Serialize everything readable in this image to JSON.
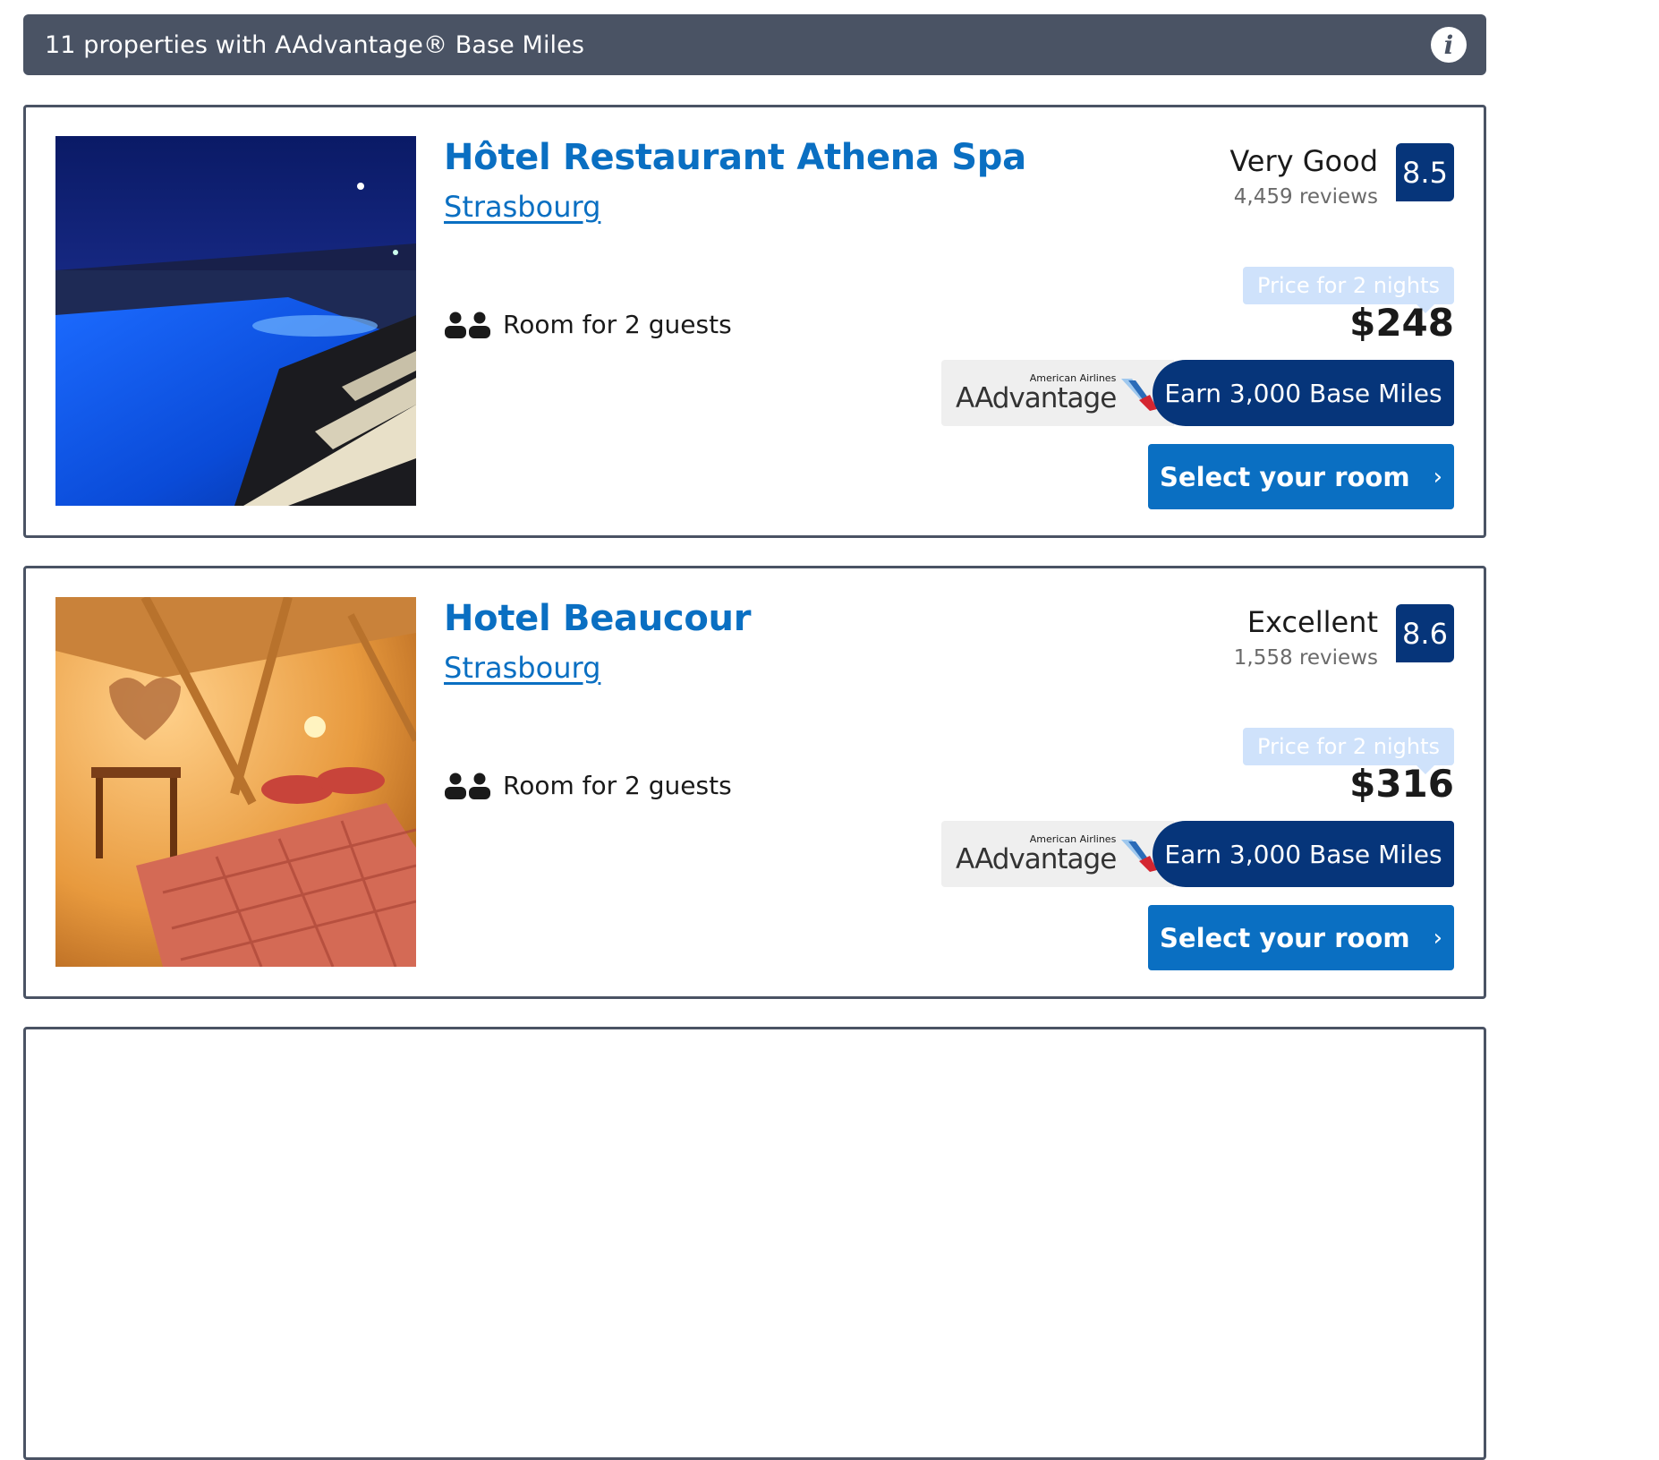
{
  "banner": {
    "text": "11 properties with AAdvantage® Base Miles",
    "icon": "info-icon"
  },
  "hotels": [
    {
      "name": "Hôtel Restaurant Athena Spa",
      "city": "Strasbourg",
      "guests": "Room for 2 guests",
      "rating_word": "Very Good",
      "reviews": "4,459 reviews",
      "score": "8.5",
      "price_label": "Price for 2 nights",
      "price": "$248",
      "aa_small": "American Airlines",
      "aa_big": "AAdvantage",
      "earn": "Earn 3,000 Base Miles",
      "select": "Select your room",
      "photo": "indoor-pool-photo"
    },
    {
      "name": "Hotel Beaucour",
      "city": "Strasbourg",
      "guests": "Room for 2 guests",
      "rating_word": "Excellent",
      "reviews": "1,558 reviews",
      "score": "8.6",
      "price_label": "Price for 2 nights",
      "price": "$316",
      "aa_small": "American Airlines",
      "aa_big": "AAdvantage",
      "earn": "Earn 3,000 Base Miles",
      "select": "Select your room",
      "photo": "bedroom-photo"
    }
  ],
  "colors": {
    "banner_bg": "#4a5364",
    "link_blue": "#0a6fc2",
    "navy": "#06357a"
  }
}
